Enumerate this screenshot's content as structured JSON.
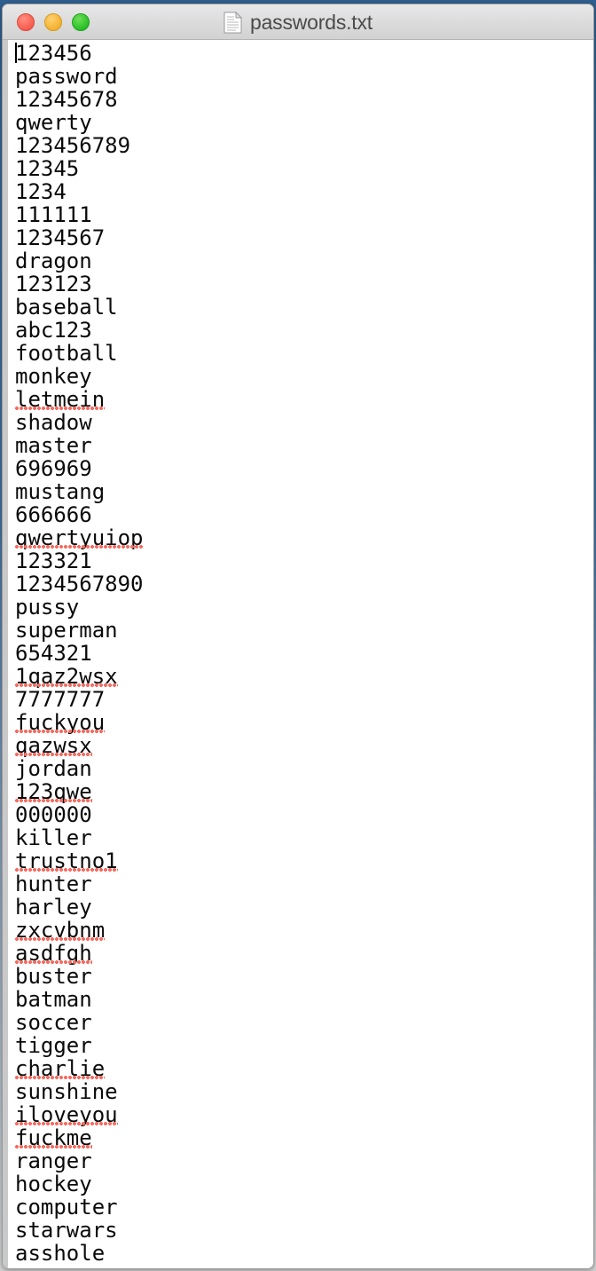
{
  "window": {
    "title": "passwords.txt",
    "doc_icon": "document-icon",
    "controls": [
      {
        "name": "close-button",
        "label": "Close",
        "color": "#f6594c"
      },
      {
        "name": "minimize-button",
        "label": "Minimize",
        "color": "#f2b02c"
      },
      {
        "name": "zoom-button",
        "label": "Zoom",
        "color": "#23bd23"
      }
    ]
  },
  "editor": {
    "caret_line": 1,
    "caret_column": 1,
    "text_color": "#0a0a0a",
    "spellcheck_color": "#f96a5f",
    "lines": [
      {
        "text": "123456",
        "misspelled": false
      },
      {
        "text": "password",
        "misspelled": false
      },
      {
        "text": "12345678",
        "misspelled": false
      },
      {
        "text": "qwerty",
        "misspelled": false
      },
      {
        "text": "123456789",
        "misspelled": false
      },
      {
        "text": "12345",
        "misspelled": false
      },
      {
        "text": "1234",
        "misspelled": false
      },
      {
        "text": "111111",
        "misspelled": false
      },
      {
        "text": "1234567",
        "misspelled": false
      },
      {
        "text": "dragon",
        "misspelled": false
      },
      {
        "text": "123123",
        "misspelled": false
      },
      {
        "text": "baseball",
        "misspelled": false
      },
      {
        "text": "abc123",
        "misspelled": false
      },
      {
        "text": "football",
        "misspelled": false
      },
      {
        "text": "monkey",
        "misspelled": false
      },
      {
        "text": "letmein",
        "misspelled": true
      },
      {
        "text": "shadow",
        "misspelled": false
      },
      {
        "text": "master",
        "misspelled": false
      },
      {
        "text": "696969",
        "misspelled": false
      },
      {
        "text": "mustang",
        "misspelled": false
      },
      {
        "text": "666666",
        "misspelled": false
      },
      {
        "text": "qwertyuiop",
        "misspelled": true
      },
      {
        "text": "123321",
        "misspelled": false
      },
      {
        "text": "1234567890",
        "misspelled": false
      },
      {
        "text": "pussy",
        "misspelled": false
      },
      {
        "text": "superman",
        "misspelled": false
      },
      {
        "text": "654321",
        "misspelled": false
      },
      {
        "text": "1qaz2wsx",
        "misspelled": true
      },
      {
        "text": "7777777",
        "misspelled": false
      },
      {
        "text": "fuckyou",
        "misspelled": true
      },
      {
        "text": "qazwsx",
        "misspelled": true
      },
      {
        "text": "jordan",
        "misspelled": false
      },
      {
        "text": "123qwe",
        "misspelled": true
      },
      {
        "text": "000000",
        "misspelled": false
      },
      {
        "text": "killer",
        "misspelled": false
      },
      {
        "text": "trustno1",
        "misspelled": true
      },
      {
        "text": "hunter",
        "misspelled": false
      },
      {
        "text": "harley",
        "misspelled": false
      },
      {
        "text": "zxcvbnm",
        "misspelled": true
      },
      {
        "text": "asdfgh",
        "misspelled": true
      },
      {
        "text": "buster",
        "misspelled": false
      },
      {
        "text": "batman",
        "misspelled": false
      },
      {
        "text": "soccer",
        "misspelled": false
      },
      {
        "text": "tigger",
        "misspelled": false
      },
      {
        "text": "charlie",
        "misspelled": true
      },
      {
        "text": "sunshine",
        "misspelled": false
      },
      {
        "text": "iloveyou",
        "misspelled": true
      },
      {
        "text": "fuckme",
        "misspelled": true
      },
      {
        "text": "ranger",
        "misspelled": false
      },
      {
        "text": "hockey",
        "misspelled": false
      },
      {
        "text": "computer",
        "misspelled": false
      },
      {
        "text": "starwars",
        "misspelled": false
      },
      {
        "text": "asshole",
        "misspelled": false
      }
    ]
  }
}
